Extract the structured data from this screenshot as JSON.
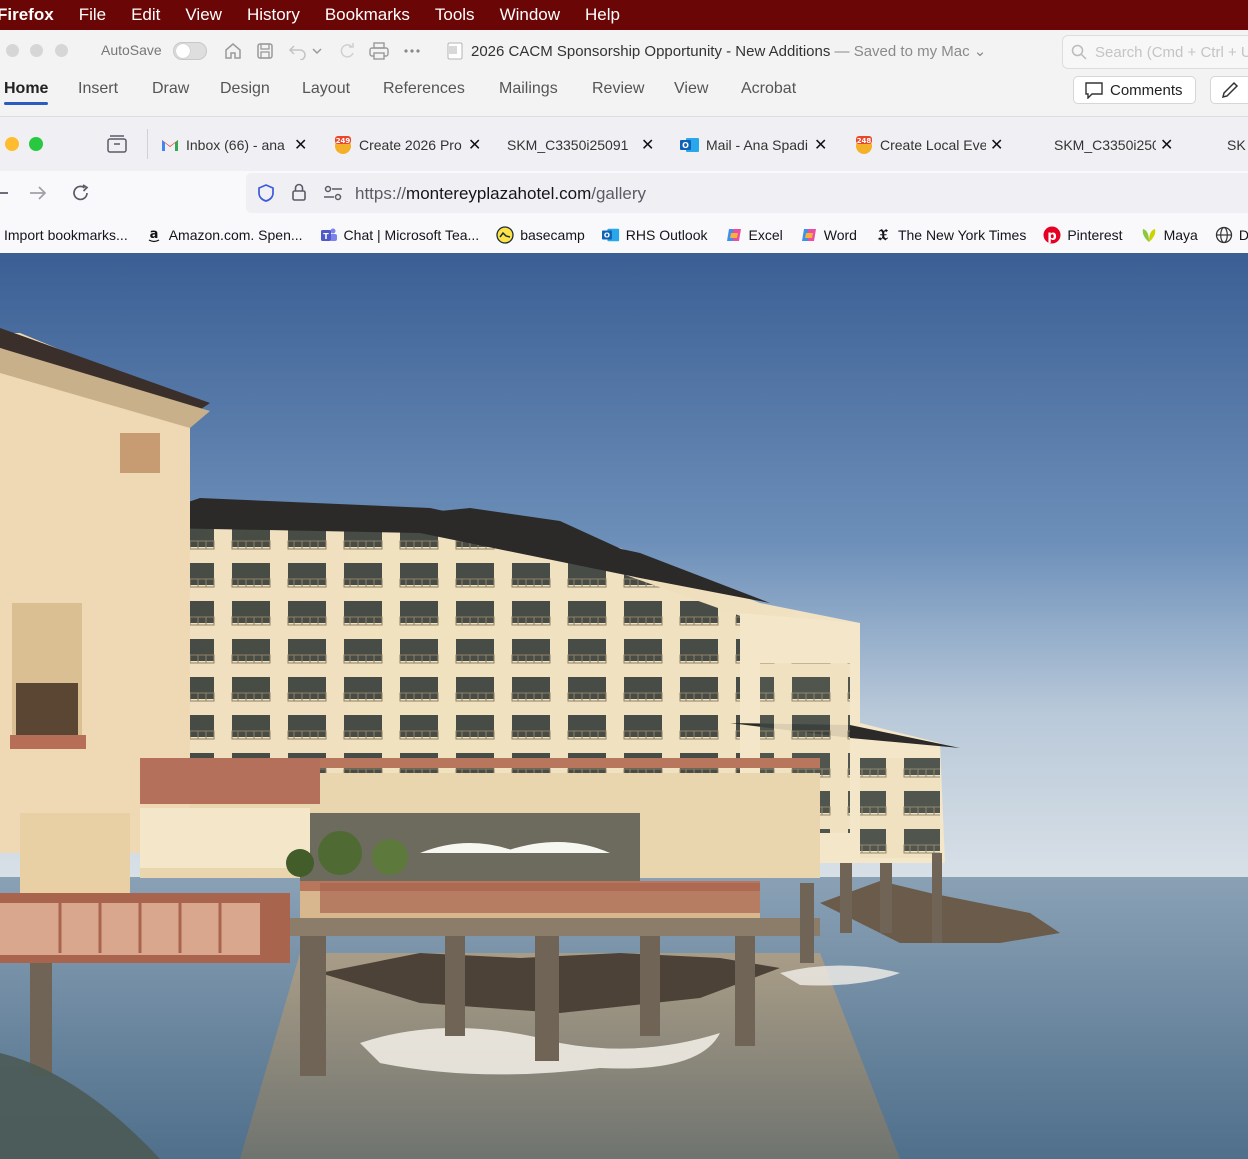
{
  "menubar": {
    "app": "Firefox",
    "items": [
      "File",
      "Edit",
      "View",
      "History",
      "Bookmarks",
      "Tools",
      "Window",
      "Help"
    ]
  },
  "word": {
    "autosave_label": "AutoSave",
    "doc_title": "2026 CACM Sponsorship Opportunity - New Additions",
    "save_status": "— Saved to my Mac",
    "search_placeholder": "Search (Cmd + Ctrl + U)",
    "ribbon_tabs": [
      "Home",
      "Insert",
      "Draw",
      "Design",
      "Layout",
      "References",
      "Mailings",
      "Review",
      "View",
      "Acrobat"
    ],
    "active_tab": "Home",
    "comments_label": "Comments"
  },
  "tabs": [
    {
      "title": "Inbox (66) - ana",
      "icon": "gmail-icon"
    },
    {
      "title": "Create 2026 Pro",
      "icon": "badge-249-icon",
      "badge": "249"
    },
    {
      "title": "SKM_C3350i25091",
      "icon": "none"
    },
    {
      "title": "Mail - Ana Spadi",
      "icon": "outlook-icon"
    },
    {
      "title": "Create Local Eve",
      "icon": "badge-248-icon",
      "badge": "248"
    },
    {
      "title": "SKM_C3350i250",
      "icon": "none"
    },
    {
      "title": "SK",
      "icon": "none"
    }
  ],
  "urlbar": {
    "scheme": "https://",
    "host": "montereyplazahotel.com",
    "path": "/gallery"
  },
  "bookmarks": [
    {
      "label": "Import bookmarks...",
      "icon": "none"
    },
    {
      "label": "Amazon.com. Spen...",
      "icon": "amazon-icon"
    },
    {
      "label": "Chat | Microsoft Tea...",
      "icon": "teams-icon"
    },
    {
      "label": "basecamp",
      "icon": "basecamp-icon"
    },
    {
      "label": "RHS Outlook",
      "icon": "outlook-icon"
    },
    {
      "label": "Excel",
      "icon": "copilot-icon"
    },
    {
      "label": "Word",
      "icon": "copilot-icon"
    },
    {
      "label": "The New York Times",
      "icon": "nyt-icon"
    },
    {
      "label": "Pinterest",
      "icon": "pinterest-icon"
    },
    {
      "label": "Maya",
      "icon": "leaf-icon"
    },
    {
      "label": "Di",
      "icon": "globe-icon"
    }
  ],
  "colors": {
    "menubar_bg": "#6b0606",
    "ribbon_accent": "#2b5cc0",
    "sky_top": "#3b5f94",
    "sea": "#5d7e9a"
  }
}
